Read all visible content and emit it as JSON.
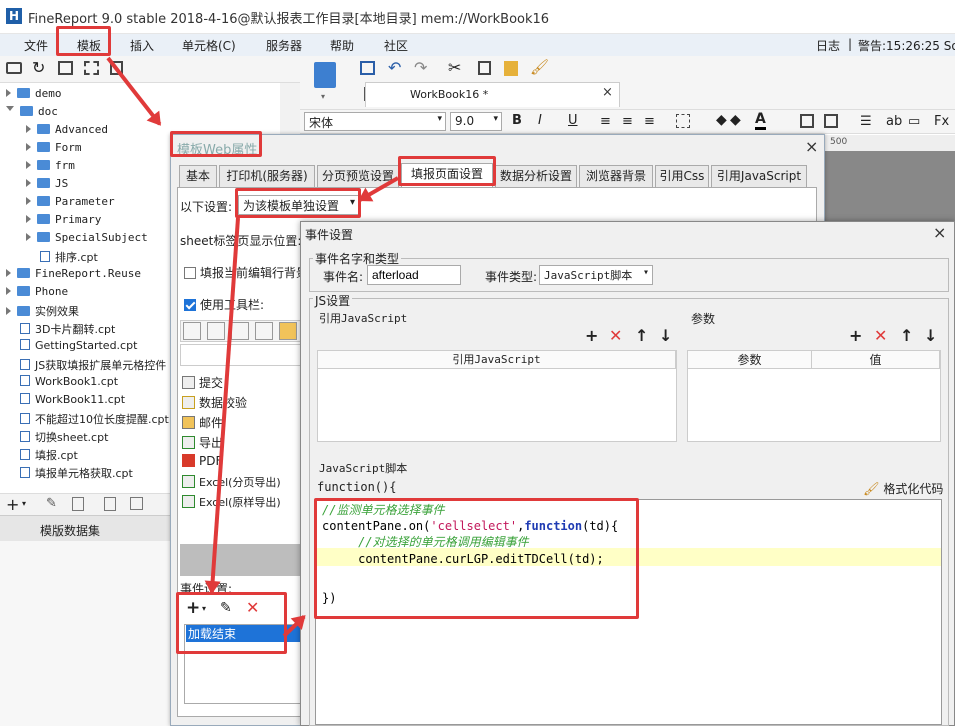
{
  "app": {
    "title": "FineReport 9.0 stable 2018-4-16@默认报表工作目录[本地目录]    mem://WorkBook16",
    "logo": "H"
  },
  "menu": [
    "文件",
    "模板",
    "插入",
    "单元格(C)",
    "服务器",
    "帮助",
    "社区"
  ],
  "status": {
    "log": "日志",
    "sep": "|",
    "alarm": "警告:15:26:25 So"
  },
  "tree": [
    {
      "label": "demo",
      "kind": "folder",
      "depth": 0,
      "open": false
    },
    {
      "label": "doc",
      "kind": "folder",
      "depth": 0,
      "open": true
    },
    {
      "label": "Advanced",
      "kind": "folder",
      "depth": 1,
      "open": false
    },
    {
      "label": "Form",
      "kind": "folder",
      "depth": 1,
      "open": false
    },
    {
      "label": "frm",
      "kind": "folder",
      "depth": 1,
      "open": false
    },
    {
      "label": "JS",
      "kind": "folder",
      "depth": 1,
      "open": false
    },
    {
      "label": "Parameter",
      "kind": "folder",
      "depth": 1,
      "open": false
    },
    {
      "label": "Primary",
      "kind": "folder",
      "depth": 1,
      "open": false
    },
    {
      "label": "SpecialSubject",
      "kind": "folder",
      "depth": 1,
      "open": false
    },
    {
      "label": "排序.cpt",
      "kind": "file",
      "depth": 1
    },
    {
      "label": "FineReport.Reuse",
      "kind": "folder",
      "depth": 0,
      "open": false
    },
    {
      "label": "Phone",
      "kind": "folder",
      "depth": 0,
      "open": false
    },
    {
      "label": "实例效果",
      "kind": "folder",
      "depth": 0,
      "open": false
    },
    {
      "label": "3D卡片翻转.cpt",
      "kind": "file",
      "depth": 0
    },
    {
      "label": "GettingStarted.cpt",
      "kind": "file",
      "depth": 0
    },
    {
      "label": "JS获取填报扩展单元格控件",
      "kind": "file",
      "depth": 0
    },
    {
      "label": "WorkBook1.cpt",
      "kind": "file",
      "depth": 0
    },
    {
      "label": "WorkBook11.cpt",
      "kind": "file",
      "depth": 0
    },
    {
      "label": "不能超过10位长度提醒.cpt",
      "kind": "file",
      "depth": 0
    },
    {
      "label": "切换sheet.cpt",
      "kind": "file",
      "depth": 0
    },
    {
      "label": "填报.cpt",
      "kind": "file",
      "depth": 0
    },
    {
      "label": "填报单元格获取.cpt",
      "kind": "file",
      "depth": 0
    }
  ],
  "left_tab": "模版数据集",
  "editor": {
    "sheet_tab": "WorkBook16 *",
    "font": "宋体",
    "font_size": "9.0",
    "ruler": "500"
  },
  "web_dialog": {
    "title": "模板Web属性",
    "tabs": [
      "基本",
      "打印机(服务器)",
      "分页预览设置",
      "填报页面设置",
      "数据分析设置",
      "浏览器背景",
      "引用Css",
      "引用JavaScript"
    ],
    "active_tab": 3,
    "setting_label": "以下设置:",
    "setting_value": "为该模板单独设置",
    "sheet_pos_label": "sheet标签页显示位置:",
    "edit_row_label": "填报当前编辑行背景",
    "use_toolbar_label": "使用工具栏:",
    "buttons": [
      "提交",
      "数据校验",
      "邮件",
      "导出",
      "PDF",
      "Excel(分页导出)",
      "Excel(原样导出)"
    ],
    "event_label": "事件设置:",
    "events": [
      "加载结束"
    ]
  },
  "event_dialog": {
    "title": "事件设置",
    "group_name": "事件名字和类型",
    "name_label": "事件名:",
    "name_value": "afterload",
    "type_label": "事件类型:",
    "type_value": "JavaScript脚本",
    "js_group": "JS设置",
    "ref_js_label": "引用JavaScript",
    "params_label": "参数",
    "ref_js_col": "引用JavaScript",
    "params_col1": "参数",
    "params_col2": "值",
    "script_label": "JavaScript脚本",
    "func_header": "function(){",
    "format_btn": "格式化代码",
    "code": [
      {
        "text": "//监测单元格选择事件",
        "color": "#3aa23a"
      },
      {
        "parts": [
          [
            "contentPane.on(",
            "#000"
          ],
          [
            "'cellselect'",
            "#c2185b"
          ],
          [
            ",",
            "#000"
          ],
          [
            "function",
            "#1f3bb3"
          ],
          [
            "(td){",
            "#000"
          ]
        ]
      },
      {
        "text": "     //对选择的单元格调用编辑事件",
        "color": "#3aa23a"
      },
      {
        "text": "     contentPane.curLGP.editTDCell(td);",
        "color": "#000"
      },
      {
        "text": "",
        "color": "#000"
      },
      {
        "text": "})",
        "color": "#000"
      }
    ]
  }
}
